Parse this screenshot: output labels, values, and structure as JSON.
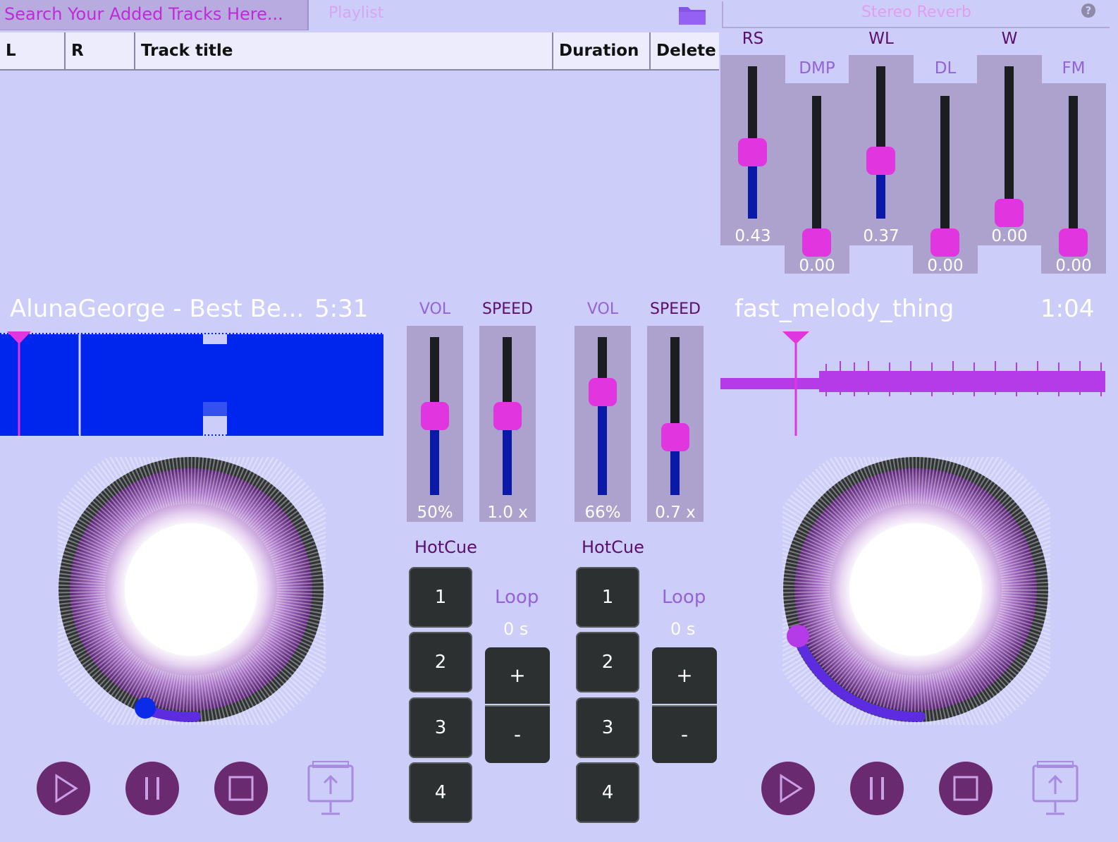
{
  "search": {
    "placeholder": "Search Your Added Tracks Here..."
  },
  "playlist": {
    "label": "Playlist"
  },
  "reverb": {
    "title": "Stereo Reverb",
    "sliders": [
      {
        "label": "RS",
        "value": "0.43",
        "level": 0.43
      },
      {
        "label": "DMP",
        "value": "0.00",
        "level": 0.0
      },
      {
        "label": "WL",
        "value": "0.37",
        "level": 0.37
      },
      {
        "label": "DL",
        "value": "0.00",
        "level": 0.0
      },
      {
        "label": "W",
        "value": "0.00",
        "level": 0.0
      },
      {
        "label": "FM",
        "value": "0.00",
        "level": 0.0
      }
    ]
  },
  "table": {
    "columns": [
      "L",
      "R",
      "Track title",
      "Duration",
      "Delete"
    ]
  },
  "deck_left": {
    "title": "AlunaGeorge - Best Be...",
    "time": "5:31",
    "vol_label": "VOL",
    "vol_value": "50%",
    "vol_level": 0.5,
    "speed_label": "SPEED",
    "speed_value": "1.0 x",
    "speed_level": 0.5,
    "hotcue_label": "HotCue",
    "hotcues": [
      "1",
      "2",
      "3",
      "4"
    ],
    "loop_label": "Loop",
    "loop_value": "0 s",
    "plus": "+",
    "minus": "-"
  },
  "deck_right": {
    "title": "fast_melody_thing",
    "time": "1:04",
    "vol_label": "VOL",
    "vol_value": "66%",
    "vol_level": 0.66,
    "speed_label": "SPEED",
    "speed_value": "0.7 x",
    "speed_level": 0.35,
    "hotcue_label": "HotCue",
    "hotcues": [
      "1",
      "2",
      "3",
      "4"
    ],
    "loop_label": "Loop",
    "loop_value": "0 s",
    "plus": "+",
    "minus": "-"
  },
  "colors": {
    "background": "#cccdf8",
    "accent_pink": "#e035df",
    "waveform_left": "#0025ec",
    "waveform_right": "#b53ae8",
    "slider_fill": "#0a1aa6"
  },
  "icons": [
    "folder-icon",
    "help-icon",
    "play-icon",
    "pause-icon",
    "stop-icon",
    "load-track-icon"
  ]
}
